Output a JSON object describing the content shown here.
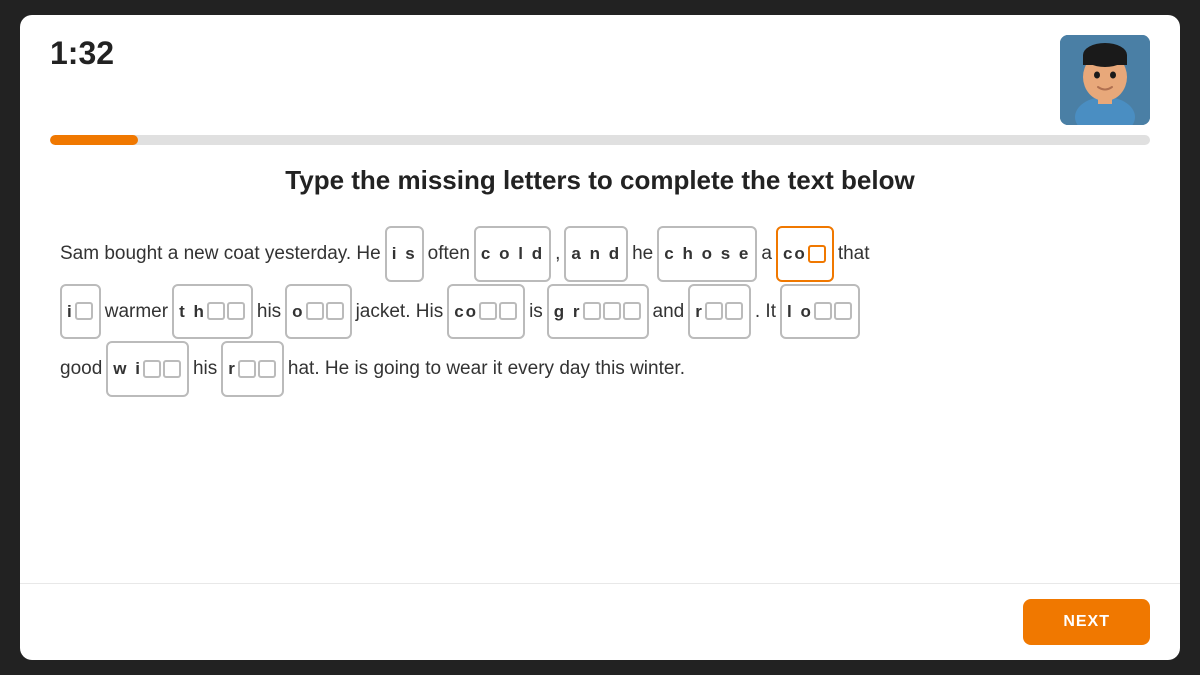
{
  "timer": "1:32",
  "progress": 8,
  "instruction": "Type the missing letters to complete the text below",
  "avatar_alt": "Instructor",
  "next_button": "NEXT",
  "sentence_parts": {
    "intro": "Sam bought a new coat yesterday. He",
    "word_is": [
      "i",
      "s"
    ],
    "often": "often",
    "word_cold": [
      "c",
      "o",
      "l",
      "d"
    ],
    "comma": ",",
    "word_and": [
      "a",
      "n",
      "d"
    ],
    "he": "he",
    "word_chose": [
      "c",
      "h",
      "o",
      "s",
      "e"
    ],
    "a": "a",
    "word_co_blank": "co",
    "that": "that",
    "line2_i_blank": "i",
    "warmer": "warmer",
    "word_th_blank": "th",
    "his1": "his",
    "word_o_blank": "o",
    "jacket": "jacket.",
    "his2": "His",
    "word_co2_blank": "co",
    "is": "is",
    "word_gr_blank": "gr",
    "and": "and",
    "word_r_blank": "r",
    "it": "It",
    "word_lo_blank": "lo",
    "line3_good": "good",
    "word_wi_blank": "wi",
    "his3": "his",
    "word_r2_blank": "r",
    "hat_rest": "hat. He is going to wear it every day this winter."
  }
}
